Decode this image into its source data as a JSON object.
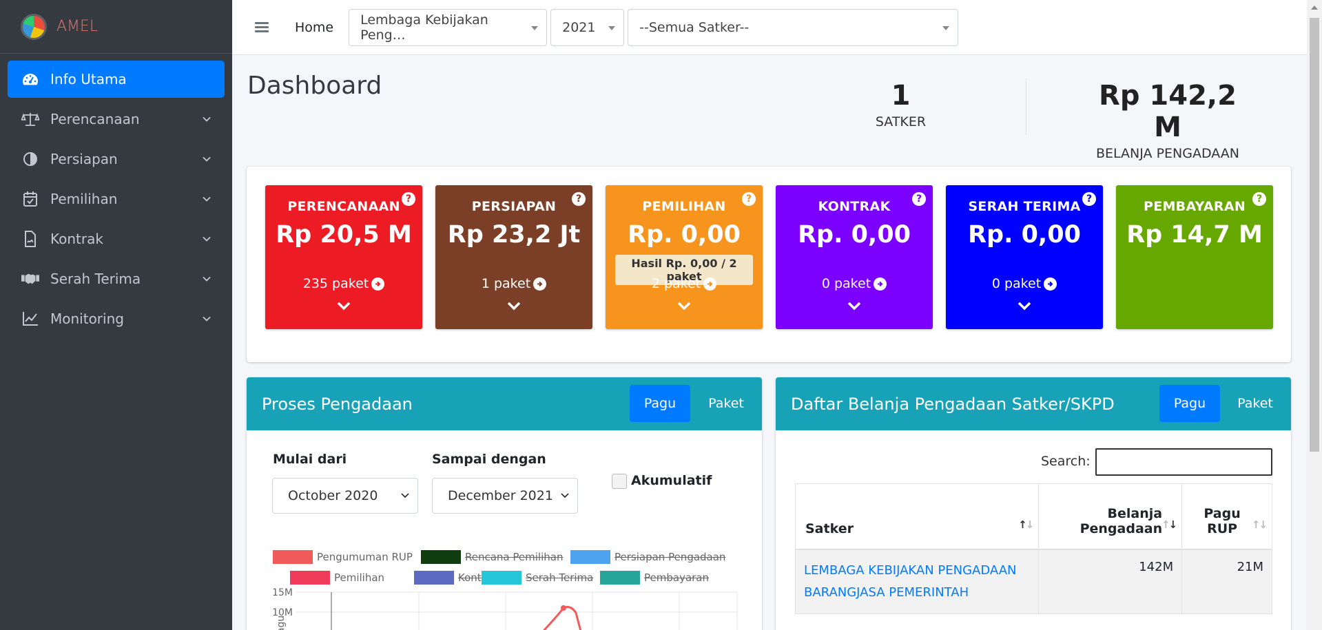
{
  "brand": {
    "name": "AMEL"
  },
  "sidebar": {
    "items": [
      {
        "label": "Info Utama",
        "icon": "dashboard-gauge-icon",
        "active": true
      },
      {
        "label": "Perencanaan",
        "icon": "balance-scale-icon"
      },
      {
        "label": "Persiapan",
        "icon": "half-circle-icon"
      },
      {
        "label": "Pemilihan",
        "icon": "calendar-check-icon"
      },
      {
        "label": "Kontrak",
        "icon": "file-contract-icon"
      },
      {
        "label": "Serah Terima",
        "icon": "handshake-icon"
      },
      {
        "label": "Monitoring",
        "icon": "line-chart-icon"
      }
    ]
  },
  "topbar": {
    "home": "Home",
    "lembaga": "Lembaga Kebijakan Peng…",
    "year": "2021",
    "satker": "--Semua Satker--"
  },
  "header": {
    "title": "Dashboard",
    "stat_satker_value": "1",
    "stat_satker_label": "SATKER",
    "stat_belanja_value": "Rp 142,2 M",
    "stat_belanja_label": "BELANJA PENGADAAN"
  },
  "cards": [
    {
      "title": "PERENCANAAN",
      "amount": "Rp 20,5 M",
      "paket": "235 paket",
      "color": "#ed1c24",
      "help": "?"
    },
    {
      "title": "PERSIAPAN",
      "amount": "Rp 23,2 Jt",
      "paket": "1 paket",
      "color": "#7b3f28",
      "help": "?"
    },
    {
      "title": "PEMILIHAN",
      "amount": "Rp. 0,00",
      "paket": "2 paket",
      "note": "Hasil Rp. 0,00 / 2 paket",
      "color": "#f7941d",
      "help": "?"
    },
    {
      "title": "KONTRAK",
      "amount": "Rp. 0,00",
      "paket": "0 paket",
      "color": "#7b00ff",
      "help": "?"
    },
    {
      "title": "SERAH TERIMA",
      "amount": "Rp. 0,00",
      "paket": "0 paket",
      "color": "#0000ff",
      "help": "?"
    },
    {
      "title": "PEMBAYARAN",
      "amount": "Rp 14,7 M",
      "color": "#66a800",
      "help": "?"
    }
  ],
  "proses": {
    "title": "Proses Pengadaan",
    "toggle_pagu": "Pagu",
    "toggle_paket": "Paket",
    "mulai_label": "Mulai dari",
    "mulai_value": "October 2020",
    "sampai_label": "Sampai dengan",
    "sampai_value": "December 2021",
    "akumulatif": "Akumulatif"
  },
  "chart_data": {
    "type": "line",
    "series": [
      {
        "name": "Pengumuman RUP",
        "color": "#f05a5a",
        "hidden": false
      },
      {
        "name": "Rencana Pemilihan",
        "color": "#0f3d0f",
        "hidden": true
      },
      {
        "name": "Persiapan Pengadaan",
        "color": "#4da3f0",
        "hidden": true
      },
      {
        "name": "Pemilihan",
        "color": "#f03a5a",
        "hidden": false
      },
      {
        "name": "Kontrak",
        "color": "#5c6bc0",
        "hidden": true
      },
      {
        "name": "Serah Terima",
        "color": "#26c6da",
        "hidden": true
      },
      {
        "name": "Pembayaran",
        "color": "#26a69a",
        "hidden": true
      }
    ],
    "yticks": [
      "15M",
      "10M"
    ],
    "ylabel": "Pagu",
    "ylim": [
      0,
      15000000
    ]
  },
  "daftar": {
    "title": "Daftar Belanja Pengadaan Satker/SKPD",
    "toggle_pagu": "Pagu",
    "toggle_paket": "Paket",
    "search_label": "Search:",
    "columns": [
      "Satker",
      "Belanja Pengadaan",
      "Pagu RUP"
    ],
    "col_belanja_1": "Belanja",
    "col_belanja_2": "Pengadaan",
    "col_pagu_1": "Pagu",
    "col_pagu_2": "RUP",
    "rows": [
      {
        "satker_line1": "LEMBAGA KEBIJAKAN PENGADAAN",
        "satker_line2": "BARANGJASA PEMERINTAH",
        "belanja": "142M",
        "pagu": "21M"
      }
    ]
  }
}
